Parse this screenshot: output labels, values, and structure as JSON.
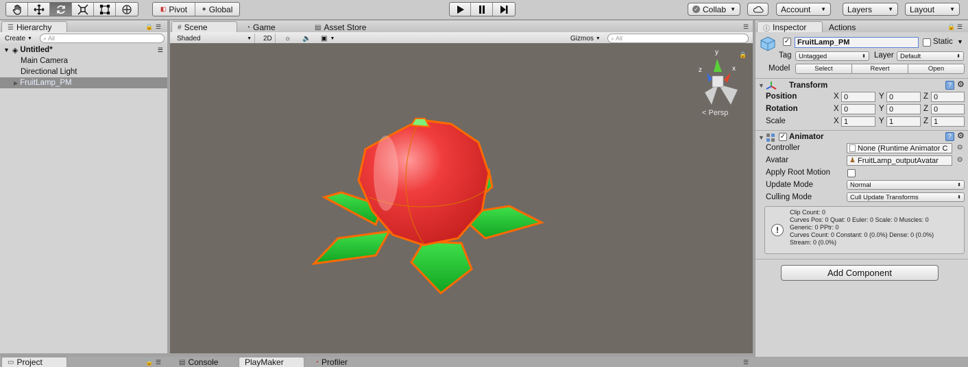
{
  "toolbar": {
    "pivot_label": "Pivot",
    "global_label": "Global",
    "collab_label": "Collab",
    "account_label": "Account",
    "layers_label": "Layers",
    "layout_label": "Layout"
  },
  "hierarchy": {
    "tab_label": "Hierarchy",
    "create_label": "Create",
    "search_placeholder": "All",
    "scene_name": "Untitled*",
    "items": [
      {
        "label": "Main Camera"
      },
      {
        "label": "Directional Light"
      },
      {
        "label": "FruitLamp_PM"
      }
    ]
  },
  "scene_tabs": {
    "scene": "Scene",
    "game": "Game",
    "asset_store": "Asset Store"
  },
  "scene_toolbar": {
    "shading": "Shaded",
    "mode_2d": "2D",
    "gizmos": "Gizmos",
    "search_placeholder": "All"
  },
  "gizmo": {
    "y": "y",
    "x": "x",
    "z": "z",
    "projection": "Persp"
  },
  "inspector": {
    "tab_label": "Inspector",
    "actions_tab": "Actions",
    "object_name": "FruitLamp_PM",
    "static_label": "Static",
    "tag_label": "Tag",
    "tag_value": "Untagged",
    "layer_label": "Layer",
    "layer_value": "Default",
    "model_label": "Model",
    "select_btn": "Select",
    "revert_btn": "Revert",
    "open_btn": "Open",
    "transform": {
      "title": "Transform",
      "position_label": "Position",
      "rotation_label": "Rotation",
      "scale_label": "Scale",
      "axis_x": "X",
      "axis_y": "Y",
      "axis_z": "Z",
      "position": {
        "x": "0",
        "y": "0",
        "z": "0"
      },
      "rotation": {
        "x": "0",
        "y": "0",
        "z": "0"
      },
      "scale": {
        "x": "1",
        "y": "1",
        "z": "1"
      }
    },
    "animator": {
      "title": "Animator",
      "controller_label": "Controller",
      "controller_value": "None (Runtime Animator C",
      "avatar_label": "Avatar",
      "avatar_value": "FruitLamp_outputAvatar",
      "apply_root_motion_label": "Apply Root Motion",
      "update_mode_label": "Update Mode",
      "update_mode_value": "Normal",
      "culling_mode_label": "Culling Mode",
      "culling_mode_value": "Cull Update Transforms",
      "info_lines": [
        "Clip Count: 0",
        "Curves Pos: 0 Quat: 0 Euler: 0 Scale: 0 Muscles: 0",
        "Generic: 0 PPtr: 0",
        "Curves Count: 0 Constant: 0 (0.0%) Dense: 0 (0.0%)",
        "Stream: 0 (0.0%)"
      ]
    },
    "add_component": "Add Component"
  },
  "bottom_tabs": {
    "project": "Project",
    "console": "Console",
    "playmaker": "PlayMaker",
    "profiler": "Profiler"
  },
  "icons": [
    "hand-icon",
    "move-icon",
    "rotate-icon",
    "scale-icon",
    "rect-icon",
    "transform-icon",
    "play-icon",
    "pause-icon",
    "step-icon",
    "cloud-icon",
    "lock-icon",
    "menu-icon",
    "sun-icon",
    "audio-icon",
    "image-icon",
    "gear-icon",
    "help-icon",
    "info-icon"
  ]
}
